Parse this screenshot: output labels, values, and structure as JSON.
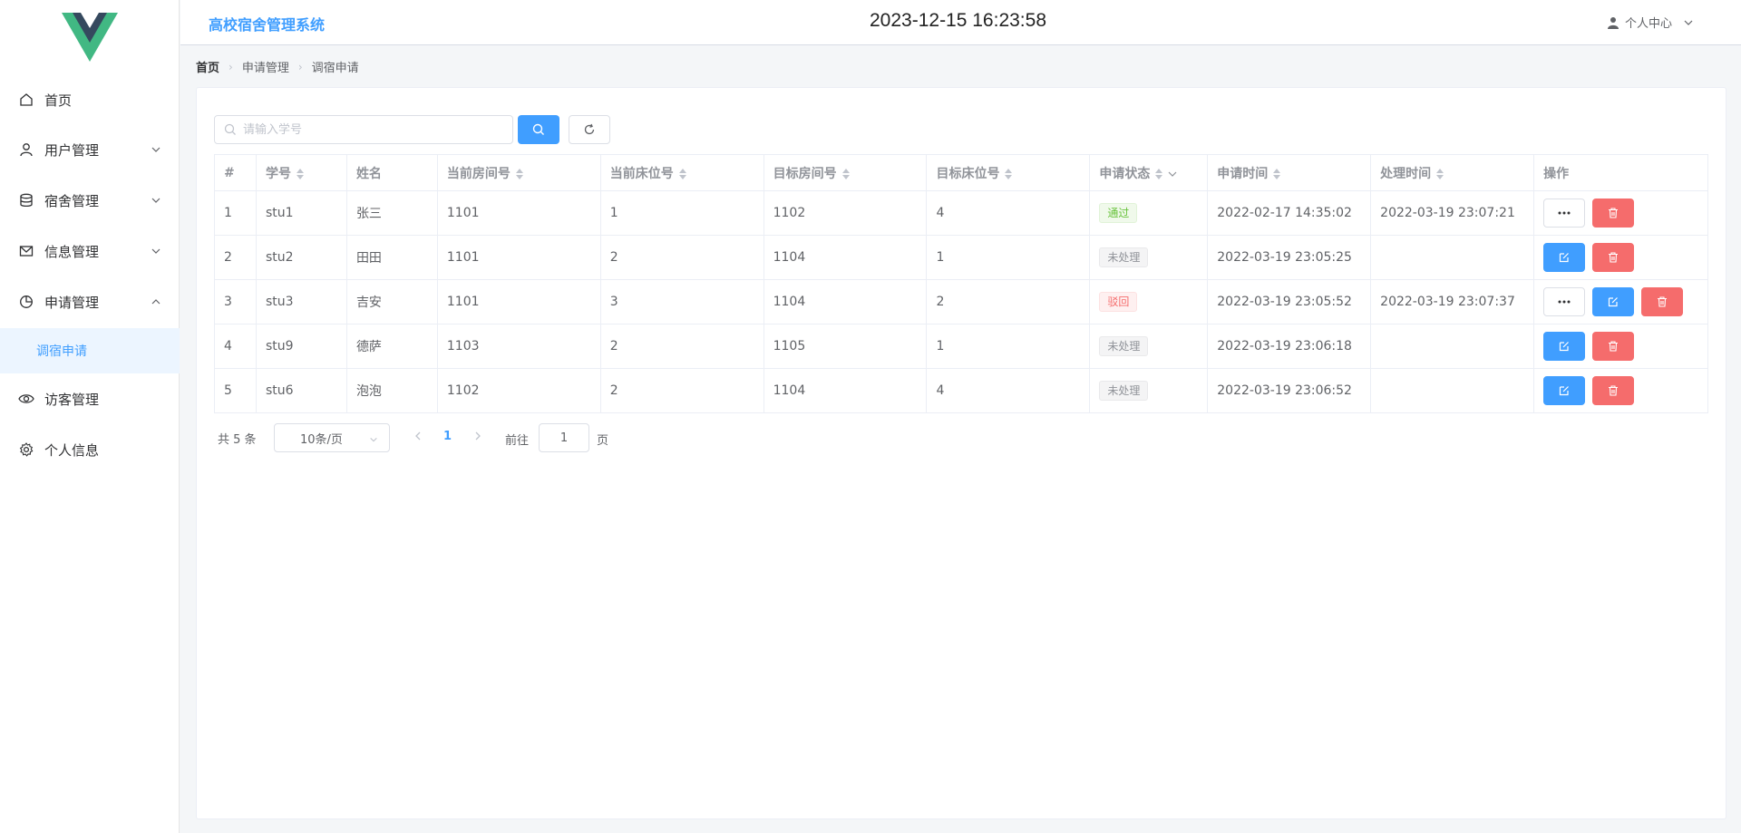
{
  "header": {
    "app_title": "高校宿舍管理系统",
    "clock": "2023-12-15 16:23:58",
    "user_center": "个人中心"
  },
  "sidebar": {
    "items": [
      {
        "label": "首页",
        "icon": "home-icon"
      },
      {
        "label": "用户管理",
        "icon": "user-icon",
        "expandable": true
      },
      {
        "label": "宿舍管理",
        "icon": "database-icon",
        "expandable": true
      },
      {
        "label": "信息管理",
        "icon": "message-icon",
        "expandable": true
      },
      {
        "label": "申请管理",
        "icon": "pie-chart-icon",
        "expandable": true,
        "expanded": true
      },
      {
        "label": "访客管理",
        "icon": "eye-icon"
      },
      {
        "label": "个人信息",
        "icon": "gear-icon"
      }
    ],
    "active_sub": "调宿申请"
  },
  "breadcrumb": [
    "首页",
    "申请管理",
    "调宿申请"
  ],
  "search": {
    "placeholder": "请输入学号"
  },
  "table": {
    "headers": [
      "#",
      "学号",
      "姓名",
      "当前房间号",
      "当前床位号",
      "目标房间号",
      "目标床位号",
      "申请状态",
      "申请时间",
      "处理时间",
      "操作"
    ],
    "rows": [
      {
        "idx": "1",
        "sid": "stu1",
        "name": "张三",
        "cur_room": "1101",
        "cur_bed": "1",
        "tgt_room": "1102",
        "tgt_bed": "4",
        "status": "通过",
        "status_type": "success",
        "apply_time": "2022-02-17 14:35:02",
        "handle_time": "2022-03-19 23:07:21",
        "ops": [
          "more",
          "delete"
        ]
      },
      {
        "idx": "2",
        "sid": "stu2",
        "name": "田田",
        "cur_room": "1101",
        "cur_bed": "2",
        "tgt_room": "1104",
        "tgt_bed": "1",
        "status": "未处理",
        "status_type": "info",
        "apply_time": "2022-03-19 23:05:25",
        "handle_time": "",
        "ops": [
          "edit",
          "delete"
        ]
      },
      {
        "idx": "3",
        "sid": "stu3",
        "name": "吉安",
        "cur_room": "1101",
        "cur_bed": "3",
        "tgt_room": "1104",
        "tgt_bed": "2",
        "status": "驳回",
        "status_type": "danger",
        "apply_time": "2022-03-19 23:05:52",
        "handle_time": "2022-03-19 23:07:37",
        "ops": [
          "more",
          "edit",
          "delete"
        ]
      },
      {
        "idx": "4",
        "sid": "stu9",
        "name": "德萨",
        "cur_room": "1103",
        "cur_bed": "2",
        "tgt_room": "1105",
        "tgt_bed": "1",
        "status": "未处理",
        "status_type": "info",
        "apply_time": "2022-03-19 23:06:18",
        "handle_time": "",
        "ops": [
          "edit",
          "delete"
        ]
      },
      {
        "idx": "5",
        "sid": "stu6",
        "name": "泡泡",
        "cur_room": "1102",
        "cur_bed": "2",
        "tgt_room": "1104",
        "tgt_bed": "4",
        "status": "未处理",
        "status_type": "info",
        "apply_time": "2022-03-19 23:06:52",
        "handle_time": "",
        "ops": [
          "edit",
          "delete"
        ]
      }
    ]
  },
  "pagination": {
    "total_text": "共 5 条",
    "page_size": "10条/页",
    "current_page": "1",
    "goto_label": "前往",
    "goto_value": "1",
    "goto_suffix": "页"
  },
  "colors": {
    "primary": "#409eff",
    "danger": "#f56c6c",
    "success": "#67c23a",
    "logo_dark": "#35495e",
    "logo_green": "#41b883"
  }
}
